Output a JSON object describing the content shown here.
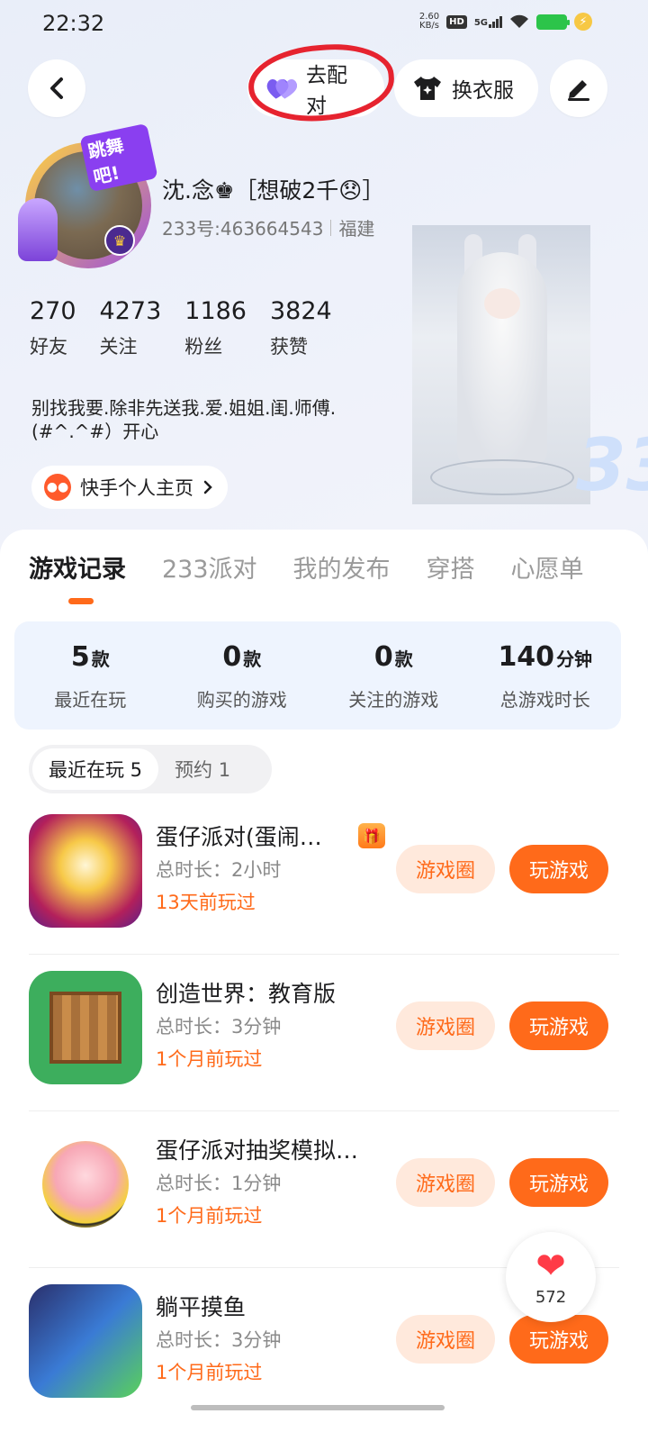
{
  "status_bar": {
    "time": "22:32",
    "net_speed_value": "2.60",
    "net_speed_unit": "KB/s",
    "hd_label": "HD",
    "network_label": "5G"
  },
  "top_bar": {
    "match_label": "去配对",
    "dress_label": "换衣服"
  },
  "profile": {
    "avatar_badge": "跳舞吧!",
    "name": "沈.念♚［想破2千😞］",
    "uid": "233号:463664543",
    "region": "福建",
    "stats": [
      {
        "num": "270",
        "label": "好友"
      },
      {
        "num": "4273",
        "label": "关注"
      },
      {
        "num": "1186",
        "label": "粉丝"
      },
      {
        "num": "3824",
        "label": "获赞"
      }
    ],
    "bio_line1": "别找我要.除非先送我.爱.姐姐.闺.师傅.",
    "bio_line2": "(#^.^#）开心",
    "kuaishou_label": "快手个人主页",
    "deco_text": "33"
  },
  "tabs": [
    "游戏记录",
    "233派对",
    "我的发布",
    "穿搭",
    "心愿单"
  ],
  "summary": [
    {
      "value": "5",
      "unit": "款",
      "caption": "最近在玩"
    },
    {
      "value": "0",
      "unit": "款",
      "caption": "购买的游戏"
    },
    {
      "value": "0",
      "unit": "款",
      "caption": "关注的游戏"
    },
    {
      "value": "140",
      "unit": "分钟",
      "caption": "总游戏时长"
    }
  ],
  "subtabs": [
    "最近在玩 5",
    "预约 1"
  ],
  "games": [
    {
      "name": "蛋仔派对(蛋闹…",
      "time": "总时长：2小时",
      "last": "13天前玩过",
      "circle_label": "游戏圈",
      "play_label": "玩游戏"
    },
    {
      "name": "创造世界：教育版",
      "time": "总时长：3分钟",
      "last": "1个月前玩过",
      "circle_label": "游戏圈",
      "play_label": "玩游戏"
    },
    {
      "name": "蛋仔派对抽奖模拟…",
      "time": "总时长：1分钟",
      "last": "1个月前玩过",
      "circle_label": "游戏圈",
      "play_label": "玩游戏"
    },
    {
      "name": "躺平摸鱼",
      "time": "总时长：3分钟",
      "last": "1个月前玩过",
      "circle_label": "游戏圈",
      "play_label": "玩游戏"
    }
  ],
  "like": {
    "count": "572"
  },
  "colors": {
    "accent": "#ff6a1a",
    "accent_light": "#ffe9dc",
    "annotation_red": "#e6232f"
  }
}
